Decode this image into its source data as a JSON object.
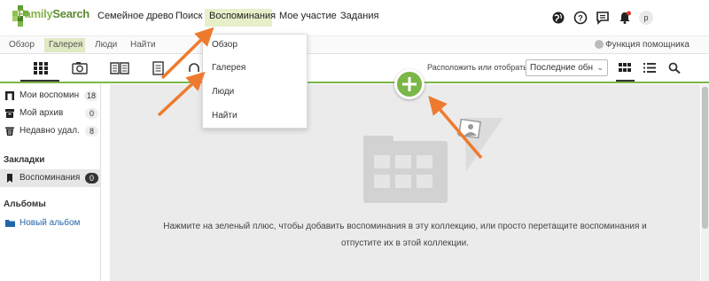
{
  "brand": {
    "name_part1": "Family",
    "name_part2": "Search"
  },
  "topnav": {
    "items": [
      "Семейное древо",
      "Поиск",
      "Воспоминания",
      "Мое участие",
      "Задания"
    ],
    "active": "Воспоминания"
  },
  "top_icons": [
    "globe-icon",
    "help-icon",
    "chat-icon",
    "bell-icon"
  ],
  "avatar_letter": "p",
  "subnav": {
    "items": [
      "Обзор",
      "Галерея",
      "Люди",
      "Найти"
    ],
    "active": "Галерея",
    "helper_label": "Функция помощника"
  },
  "toolbar": {
    "tools": [
      "gallery-grid-icon",
      "photo-icon",
      "story-icon",
      "document-icon",
      "audio-icon"
    ],
    "sort_label": "Расположить или отобрать:",
    "sort_value": "Последние обн",
    "view_icons": [
      "grid-view-icon",
      "list-view-icon",
      "search-icon"
    ]
  },
  "sidebar": {
    "items": [
      {
        "label": "Мои воспомин...",
        "count": "18",
        "icon": "memories-icon"
      },
      {
        "label": "Мой архив",
        "count": "0",
        "icon": "archive-icon"
      },
      {
        "label": "Недавно удал...",
        "count": "8",
        "icon": "trash-icon"
      }
    ],
    "bookmarks_heading": "Закладки",
    "bookmark": {
      "label": "Воспоминания",
      "count": "0"
    },
    "albums_heading": "Альбомы",
    "new_album": "Новый альбом"
  },
  "dropdown": {
    "items": [
      "Обзор",
      "Галерея",
      "Люди",
      "Найти"
    ]
  },
  "main": {
    "hint": "Нажмите на зеленый плюс, чтобы добавить воспоминания в эту коллекцию, или просто перетащите воспоминания и отпустите их в этой коллекции."
  },
  "colors": {
    "accent": "#7ab648",
    "arrow": "#ee7a2e",
    "active_nav": "#e6efc9"
  }
}
